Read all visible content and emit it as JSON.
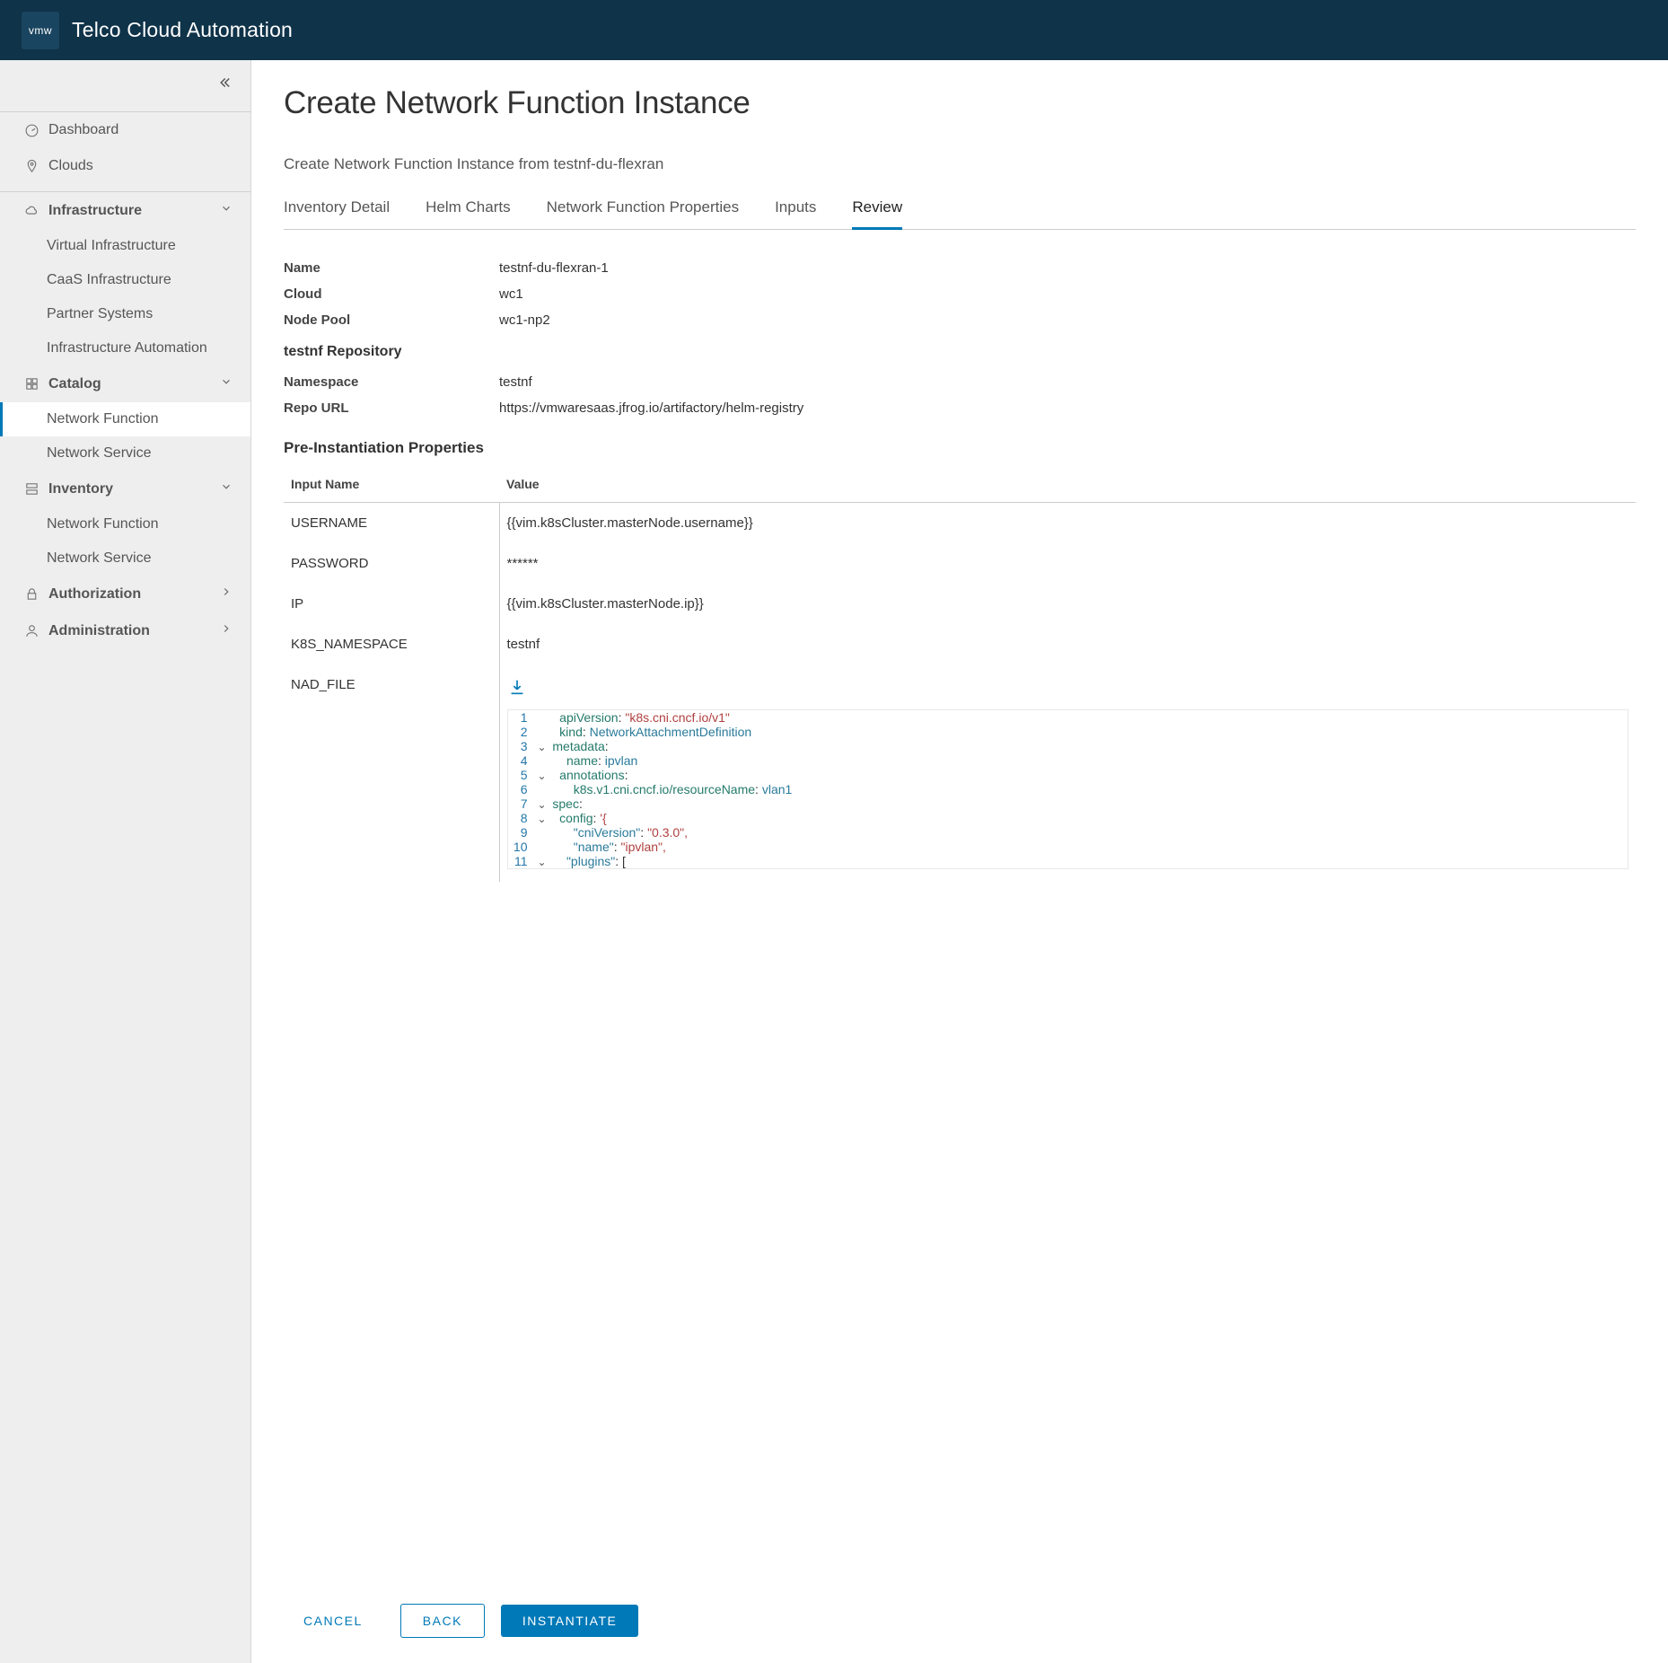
{
  "header": {
    "logo_text": "vmw",
    "product_name": "Telco Cloud Automation"
  },
  "sidebar": {
    "items": [
      {
        "label": "Dashboard"
      },
      {
        "label": "Clouds"
      }
    ],
    "groups": [
      {
        "label": "Infrastructure",
        "children": [
          {
            "label": "Virtual Infrastructure"
          },
          {
            "label": "CaaS Infrastructure"
          },
          {
            "label": "Partner Systems"
          },
          {
            "label": "Infrastructure Automation"
          }
        ]
      },
      {
        "label": "Catalog",
        "children": [
          {
            "label": "Network Function"
          },
          {
            "label": "Network Service"
          }
        ]
      },
      {
        "label": "Inventory",
        "children": [
          {
            "label": "Network Function"
          },
          {
            "label": "Network Service"
          }
        ]
      },
      {
        "label": "Authorization"
      },
      {
        "label": "Administration"
      }
    ]
  },
  "main": {
    "title": "Create Network Function Instance",
    "subtitle": "Create Network Function Instance from testnf-du-flexran",
    "tabs": [
      {
        "label": "Inventory Detail"
      },
      {
        "label": "Helm Charts"
      },
      {
        "label": "Network Function Properties"
      },
      {
        "label": "Inputs"
      },
      {
        "label": "Review"
      }
    ],
    "kv": {
      "rows": [
        {
          "label": "Name",
          "value": "testnf-du-flexran-1"
        },
        {
          "label": "Cloud",
          "value": "wc1"
        },
        {
          "label": "Node Pool",
          "value": "wc1-np2"
        }
      ],
      "repo_heading": "testnf Repository",
      "repo_rows": [
        {
          "label": "Namespace",
          "value": "testnf"
        },
        {
          "label": "Repo URL",
          "value": "https://vmwaresaas.jfrog.io/artifactory/helm-registry"
        }
      ]
    },
    "pre_inst_heading": "Pre-Instantiation Properties",
    "prop_headers": {
      "name": "Input Name",
      "value": "Value"
    },
    "props": [
      {
        "name": "USERNAME",
        "value": "{{vim.k8sCluster.masterNode.username}}"
      },
      {
        "name": "PASSWORD",
        "value": "******"
      },
      {
        "name": "IP",
        "value": "{{vim.k8sCluster.masterNode.ip}}"
      },
      {
        "name": "K8S_NAMESPACE",
        "value": "testnf"
      },
      {
        "name": "NAD_FILE",
        "value": ""
      }
    ],
    "code": {
      "l1_key": "apiVersion",
      "l1_val": "\"k8s.cni.cncf.io/v1\"",
      "l2_key": "kind",
      "l2_val": "NetworkAttachmentDefinition",
      "l3_key": "metadata",
      "l4_key": "name",
      "l4_val": "ipvlan",
      "l5_key": "annotations",
      "l6_key": "k8s.v1.cni.cncf.io/resourceName",
      "l6_val": "vlan1",
      "l7_key": "spec",
      "l8_key": "config",
      "l8_val": "'{",
      "l9_key": "\"cniVersion\"",
      "l9_val": "\"0.3.0\",",
      "l10_key": "\"name\"",
      "l10_val": "\"ipvlan\",",
      "l11_key": "\"plugins\"",
      "l11_val": "["
    }
  },
  "footer": {
    "cancel": "CANCEL",
    "back": "BACK",
    "instantiate": "INSTANTIATE"
  }
}
